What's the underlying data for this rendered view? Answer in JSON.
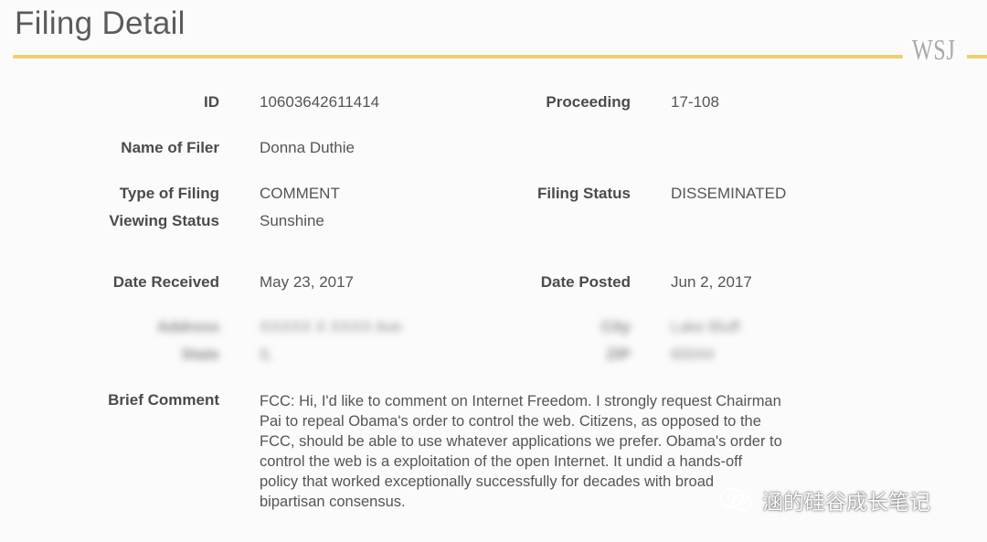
{
  "header": {
    "title": "Filing Detail",
    "brand": "WSJ"
  },
  "fields": {
    "id": {
      "label": "ID",
      "value": "10603642611414"
    },
    "proceeding": {
      "label": "Proceeding",
      "value": "17-108"
    },
    "name_of_filer": {
      "label": "Name of Filer",
      "value": "Donna Duthie"
    },
    "type_of_filing": {
      "label": "Type of Filing",
      "value": "COMMENT"
    },
    "filing_status": {
      "label": "Filing Status",
      "value": "DISSEMINATED"
    },
    "viewing_status": {
      "label": "Viewing Status",
      "value": "Sunshine"
    },
    "date_received": {
      "label": "Date Received",
      "value": "May 23, 2017"
    },
    "date_posted": {
      "label": "Date Posted",
      "value": "Jun 2, 2017"
    }
  },
  "blurred": {
    "address": {
      "label": "Address",
      "value": "XXXXX X XXXX Ave"
    },
    "city": {
      "label": "City",
      "value": "Lake Bluff"
    },
    "state": {
      "label": "State",
      "value": "IL"
    },
    "zip": {
      "label": "ZIP",
      "value": "60044"
    }
  },
  "brief_comment": {
    "label": "Brief Comment",
    "lines": [
      "FCC: Hi, I'd like to comment on Internet Freedom. I strongly request Chairman",
      "Pai to repeal Obama's order to control the web. Citizens, as opposed to the",
      "FCC, should be able to use whatever applications we prefer. Obama's order to",
      "control the web is a exploitation of the open Internet. It undid a hands-off",
      "policy that worked exceptionally successfully for decades with broad",
      "bipartisan consensus."
    ]
  },
  "watermark": {
    "text": "涵的硅谷成长笔记",
    "icon": "wechat-icon"
  }
}
